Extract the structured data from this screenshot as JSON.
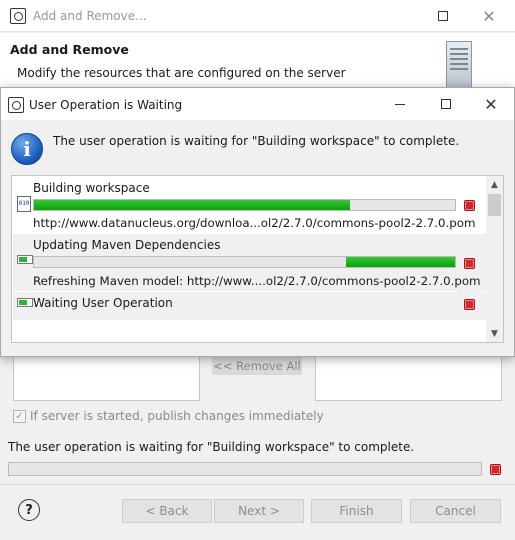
{
  "background_window": {
    "title": "Add and Remove...",
    "header_title": "Add and Remove",
    "header_description": "Modify the resources that are configured on the server",
    "remove_all_label": "<< Remove All",
    "publish_checkbox": {
      "label": "If server is started, publish changes immediately",
      "checked": true
    },
    "status_message": "The user operation is waiting for \"Building workspace\" to complete.",
    "buttons": {
      "back": "< Back",
      "next": "Next >",
      "finish": "Finish",
      "cancel": "Cancel"
    }
  },
  "dialog": {
    "title": "User Operation is Waiting",
    "message": "The user operation is waiting for \"Building workspace\" to complete.",
    "jobs": [
      {
        "name": "Building workspace",
        "detail": "http://www.datanucleus.org/downloa...ol2/2.7.0/commons-pool2-2.7.0.pom",
        "progress_start": 0.0,
        "progress_end": 0.75,
        "icon": "binary-file-icon"
      },
      {
        "name": "Updating Maven Dependencies",
        "detail": "Refreshing Maven model: http://www....ol2/2.7.0/commons-pool2-2.7.0.pom",
        "progress_start": 0.74,
        "progress_end": 1.0,
        "icon": "progress-bar-icon"
      },
      {
        "name": "Waiting User Operation",
        "icon": "progress-bar-icon"
      }
    ]
  },
  "colors": {
    "progress_green": "#06a406",
    "stop_red": "#d9242b",
    "info_blue": "#1457b8"
  }
}
